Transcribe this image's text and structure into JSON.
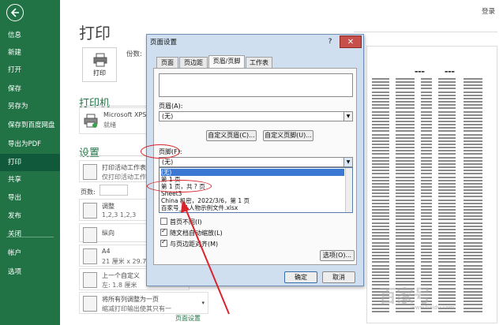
{
  "sidebar": {
    "items": [
      {
        "label": "信息"
      },
      {
        "label": "新建"
      },
      {
        "label": "打开"
      },
      {
        "label": "保存"
      },
      {
        "label": "另存为"
      },
      {
        "label": "保存到百度网盘"
      },
      {
        "label": "导出为PDF"
      },
      {
        "label": "打印",
        "active": true
      },
      {
        "label": "共享"
      },
      {
        "label": "导出"
      },
      {
        "label": "发布"
      },
      {
        "label": "关闭"
      },
      {
        "label": "帐户"
      },
      {
        "label": "选项"
      }
    ]
  },
  "header": {
    "login": "登录"
  },
  "print": {
    "title": "打印",
    "button_label": "打印",
    "copies_label": "份数:",
    "printer_section": "打印机",
    "printer_name": "Microsoft XPS",
    "printer_status": "就绪",
    "settings_section": "设置",
    "settings": [
      {
        "line1": "打印活动工作表",
        "line2": "仅打印活动工作表"
      },
      {
        "line1": "调整",
        "line2": "1,2,3   1,2,3"
      },
      {
        "line1": "纵向",
        "line2": ""
      },
      {
        "line1": "A4",
        "line2": "21 厘米 x 29.7"
      },
      {
        "line1": "上一个自定义",
        "line2": "左: 1.8 厘米"
      },
      {
        "line1": "将所有列调整为一页",
        "line2": "缩减打印输出使其只有一"
      }
    ],
    "pages_label": "页数:",
    "page_setup_link": "页面设置"
  },
  "dialog": {
    "title": "页面设置",
    "help": "?",
    "close": "✕",
    "tabs": [
      "页面",
      "页边距",
      "页眉/页脚",
      "工作表"
    ],
    "selected_tab": 2,
    "header_label": "页眉(A):",
    "header_value": "(无)",
    "custom_header_btn": "自定义页眉(C)...",
    "custom_footer_btn": "自定义页脚(U)...",
    "footer_label": "页脚(F):",
    "footer_value": "(无)",
    "footer_options": [
      "(无)",
      "第 1 页",
      "第 1 页，共 ? 页",
      "Sheet3",
      "China 机密，2022/3/6，第 1 页",
      "百家号_IT-人物示例文件.xlsx"
    ],
    "selected_option": 0,
    "checks": [
      {
        "label": "首页不同(I)",
        "checked": false
      },
      {
        "label": "随文档自动缩放(L)",
        "checked": true
      },
      {
        "label": "与页边距对齐(M)",
        "checked": true
      }
    ],
    "options_btn": "选项(O)...",
    "ok_btn": "确定",
    "cancel_btn": "取消"
  },
  "watermark": {
    "main": "百家号",
    "sub": "www.baidu.com"
  },
  "colors": {
    "sidebar": "#217346",
    "accent": "#217346",
    "annotation": "#d8242a",
    "selection": "#3a78d4"
  }
}
